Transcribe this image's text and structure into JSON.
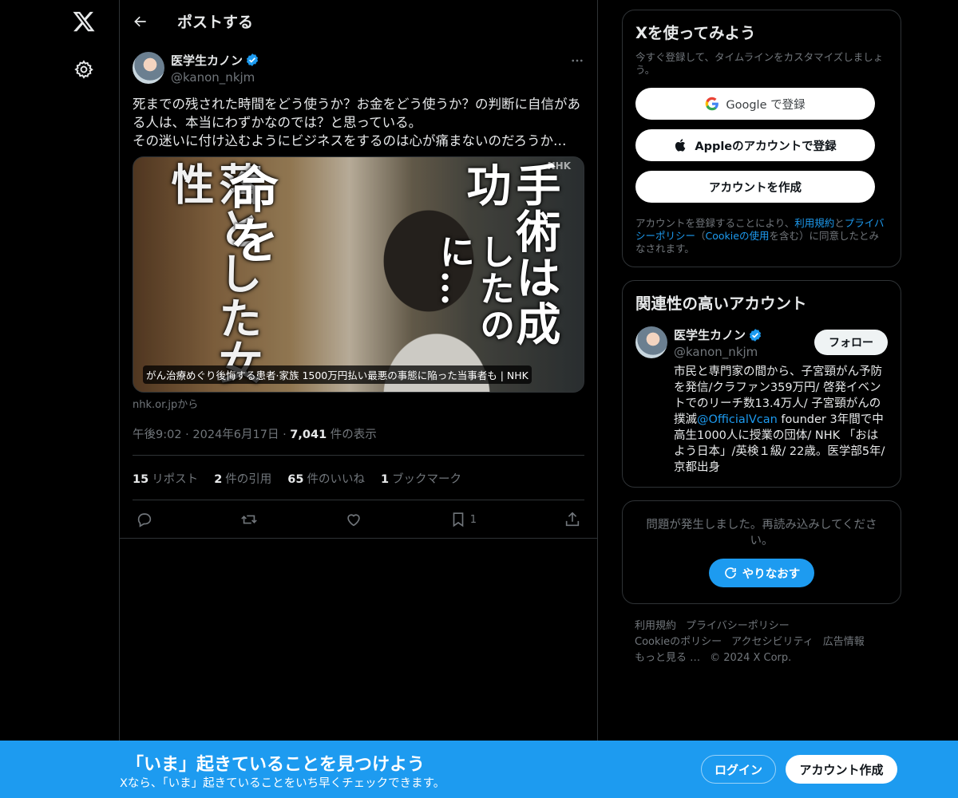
{
  "nav": {
    "logo_icon": "x-logo-icon",
    "settings_icon": "gear-icon"
  },
  "header": {
    "title": "ポストする"
  },
  "tweet": {
    "author": {
      "name": "医学生カノン",
      "handle": "@kanon_nkjm",
      "verified": true
    },
    "text": "死までの残された時間をどう使うか？お金をどう使うか？の判断に自信がある人は、本当にわずかなのでは？と思っている。\nその迷いに付け込むようにビジネスをするのは心が痛まないのだろうか…",
    "media": {
      "overlay_left_1": "落とした女性",
      "overlay_left_2": "命を",
      "overlay_right_1": "手術は成功",
      "overlay_right_2": "したのに…",
      "watermark": "NHK",
      "caption": "がん治療めぐり後悔する患者·家族 1500万円払い最悪の事態に陥った当事者も | NHK"
    },
    "source": "nhk.or.jpから",
    "time": "午後9:02",
    "date": "2024年6月17日",
    "views": "7,041",
    "views_label": " 件の表示",
    "stats": {
      "reposts": "15",
      "reposts_label": "リポスト",
      "quotes": "2",
      "quotes_label": "件の引用",
      "likes": "65",
      "likes_label": "件のいいね",
      "bookmarks": "1",
      "bookmarks_label": "ブックマーク"
    },
    "actions": {
      "bookmark_count": "1"
    }
  },
  "signup_card": {
    "title": "Xを使ってみよう",
    "subtitle": "今すぐ登録して、タイムラインをカスタマイズしましょう。",
    "google_label": "Google で登録",
    "apple_label": "Appleのアカウントで登録",
    "create_label": "アカウントを作成",
    "legal_prefix": "アカウントを登録することにより、",
    "legal_terms": "利用規約",
    "legal_and": "と",
    "legal_privacy": "プライバシーポリシー",
    "legal_paren_open": "（",
    "legal_cookie": "Cookieの使用",
    "legal_suffix": "を含む）に同意したとみなされます。"
  },
  "related": {
    "title": "関連性の高いアカウント",
    "name": "医学生カノン",
    "handle": "@kanon_nkjm",
    "follow_label": "フォロー",
    "bio_1": "市民と専門家の間から、子宮頸がん予防を発信/クラファン359万円/ 啓発イベントでのリーチ数13.4万人/ 子宮頸がんの撲滅",
    "bio_mention": "@OfficialVcan",
    "bio_2": " founder 3年間で中高生1000人に授業の団体/ NHK 「おはよう日本」/英検１級/ 22歳。医学部5年/ 京都出身"
  },
  "error_card": {
    "message": "問題が発生しました。再読み込みしてください。",
    "retry_label": "やりなおす"
  },
  "footer": {
    "links": [
      "利用規約",
      "プライバシーポリシー",
      "Cookieのポリシー",
      "アクセシビリティ",
      "広告情報",
      "もっと見る …"
    ],
    "copyright": "© 2024 X Corp."
  },
  "banner": {
    "title": "「いま」起きていることを見つけよう",
    "subtitle": "Xなら、「いま」起きていることをいち早くチェックできます。",
    "login_label": "ログイン",
    "signup_label": "アカウント作成"
  },
  "colors": {
    "accent": "#1d9bf0",
    "background": "#000000",
    "border": "#2f3336",
    "muted": "#71767b"
  }
}
